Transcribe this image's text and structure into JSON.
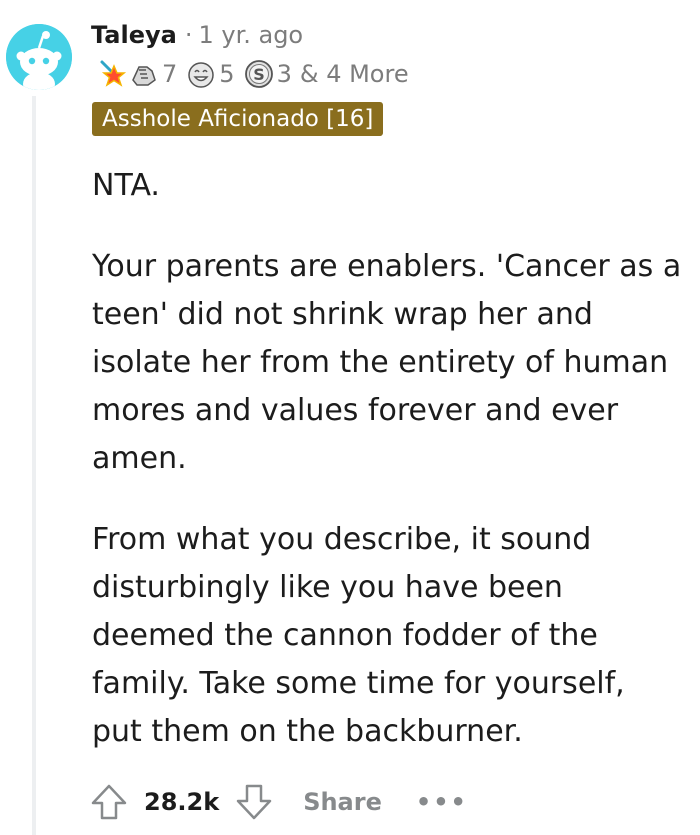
{
  "comment": {
    "author": "Taleya",
    "separator": "·",
    "time_ago": "1 yr. ago",
    "awards": [
      {
        "icon": "star-wand-award-icon",
        "count": ""
      },
      {
        "icon": "fist-bump-award-icon",
        "count": "7"
      },
      {
        "icon": "laughing-face-award-icon",
        "count": "5"
      },
      {
        "icon": "silver-coin-award-icon",
        "count": "3"
      }
    ],
    "more_awards": "& 4 More",
    "flair": "Asshole Aficionado [16]",
    "paragraphs": [
      "NTA.",
      "Your parents are enablers. 'Cancer as a teen' did not shrink wrap her and isolate her from the entirety of human mores and values forever and ever amen.",
      "From what you describe, it sound disturbingly like you have been deemed the cannon fodder of the family. Take some time for yourself, put them on the backburner."
    ],
    "score": "28.2k",
    "share_label": "Share",
    "more_label": "•••"
  },
  "colors": {
    "avatar_bg": "#46d1e6",
    "flair_bg": "#8a6e1e",
    "muted": "#7c7c7c"
  }
}
